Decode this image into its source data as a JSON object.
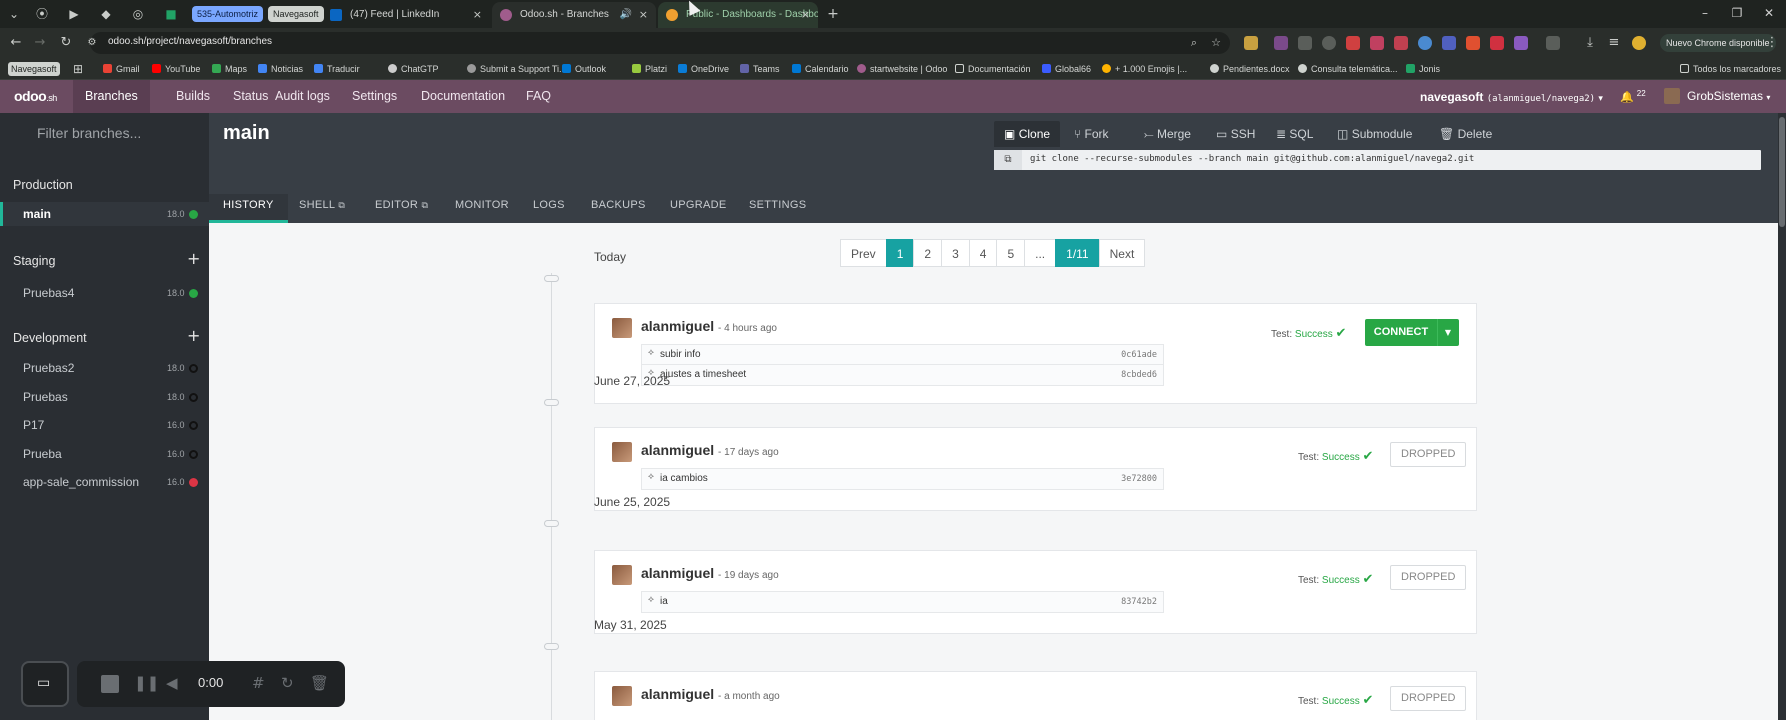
{
  "browser": {
    "tab_groups": [
      {
        "label": "535-Automotriz",
        "color": "#7aa7ff"
      },
      {
        "label": "Navegasoft",
        "color": "#cfd3cf"
      }
    ],
    "tabs": [
      {
        "title": "(47) Feed | LinkedIn",
        "icon": "linkedin-icon",
        "color": "#0a66c2"
      },
      {
        "title": "Odoo.sh - Branches",
        "icon": "odoo-icon",
        "color": "#a05c8c"
      },
      {
        "title": "Public - Dashboards - Dashboa",
        "icon": "dashboard-icon",
        "color": "#f0a030"
      }
    ],
    "url": "odoo.sh/project/navegasoft/branches",
    "update_label": "Nuevo Chrome disponible",
    "bookmarks": [
      {
        "label": "Navegasoft",
        "color": "#cfd3cf"
      },
      {
        "label": "Gmail",
        "color": "#ea4335"
      },
      {
        "label": "YouTube",
        "color": "#ff0000"
      },
      {
        "label": "Maps",
        "color": "#34a853"
      },
      {
        "label": "Noticias",
        "color": "#4285f4"
      },
      {
        "label": "Traducir",
        "color": "#4285f4"
      },
      {
        "label": "ChatGTP",
        "color": "#cccccc"
      },
      {
        "label": "Submit a Support Ti...",
        "color": "#9a9a9a"
      },
      {
        "label": "Outlook",
        "color": "#0078d4"
      },
      {
        "label": "Platzi",
        "color": "#98ca3f"
      },
      {
        "label": "OneDrive",
        "color": "#0a7cd6"
      },
      {
        "label": "Teams",
        "color": "#6264a7"
      },
      {
        "label": "Calendario",
        "color": "#0078d4"
      },
      {
        "label": "startwebsite | Odoo",
        "color": "#a05c8c"
      },
      {
        "label": "Documentación",
        "color": "#cfd3cf"
      },
      {
        "label": "Global66",
        "color": "#3b5cff"
      },
      {
        "label": "+ 1.000 Emojis |...",
        "color": "#ffb400"
      },
      {
        "label": "Pendientes.docx",
        "color": "#cfd3cf"
      },
      {
        "label": "Consulta telemática...",
        "color": "#cfd3cf"
      },
      {
        "label": "Jonis",
        "color": "#21a366"
      }
    ],
    "all_bookmarks_label": "Todos los marcadores"
  },
  "odoo_nav": {
    "logo": "odoo",
    "logo_suffix": ".sh",
    "links": [
      "Branches",
      "Builds",
      "Status",
      "Audit logs",
      "Settings",
      "Documentation",
      "FAQ"
    ],
    "project": "navegasoft",
    "project_repo": "(alanmiguel/navega2)",
    "notifications": "22",
    "user": "GrobSistemas"
  },
  "sidebar": {
    "filter_placeholder": "Filter branches...",
    "sections": [
      {
        "title": "Production",
        "branches": [
          {
            "name": "main",
            "version": "18.0",
            "status": "#28a745"
          }
        ]
      },
      {
        "title": "Staging",
        "branches": [
          {
            "name": "Pruebas4",
            "version": "18.0",
            "status": "#28a745"
          }
        ]
      },
      {
        "title": "Development",
        "branches": [
          {
            "name": "Pruebas2",
            "version": "18.0",
            "status": "#1a1a1a"
          },
          {
            "name": "Pruebas",
            "version": "18.0",
            "status": "#1a1a1a"
          },
          {
            "name": "P17",
            "version": "16.0",
            "status": "#1a1a1a"
          },
          {
            "name": "Prueba",
            "version": "16.0",
            "status": "#1a1a1a"
          },
          {
            "name": "app-sale_commission",
            "version": "16.0",
            "status": "#dc3545"
          }
        ]
      }
    ]
  },
  "header": {
    "branch": "main",
    "actions": [
      "Clone",
      "Fork",
      "Merge",
      "SSH",
      "SQL",
      "Submodule",
      "Delete"
    ],
    "clone_command": "git clone --recurse-submodules --branch main git@github.com:alanmiguel/navega2.git",
    "tabs": [
      "HISTORY",
      "SHELL",
      "EDITOR",
      "MONITOR",
      "LOGS",
      "BACKUPS",
      "UPGRADE",
      "SETTINGS"
    ]
  },
  "pager": {
    "prev": "Prev",
    "pages": [
      "1",
      "2",
      "3",
      "4",
      "5",
      "..."
    ],
    "current": "1/11",
    "next": "Next"
  },
  "history": [
    {
      "day": "Today",
      "author": "alanmiguel",
      "ago": "- 4 hours ago",
      "commits": [
        {
          "message": "subir info",
          "hash": "0c61ade"
        },
        {
          "message": "ajustes a timesheet",
          "hash": "8cbded6"
        }
      ],
      "test_label": "Test:",
      "test_result": "Success",
      "action": "CONNECT"
    },
    {
      "day": "June 27, 2025",
      "author": "alanmiguel",
      "ago": "- 17 days ago",
      "commits": [
        {
          "message": "ia cambios",
          "hash": "3e72800"
        }
      ],
      "test_label": "Test:",
      "test_result": "Success",
      "action": "DROPPED"
    },
    {
      "day": "June 25, 2025",
      "author": "alanmiguel",
      "ago": "- 19 days ago",
      "commits": [
        {
          "message": "ia",
          "hash": "83742b2"
        }
      ],
      "test_label": "Test:",
      "test_result": "Success",
      "action": "DROPPED"
    },
    {
      "day": "May 31, 2025",
      "author": "alanmiguel",
      "ago": "- a month ago",
      "commits": [],
      "test_label": "Test:",
      "test_result": "Success",
      "action": "DROPPED"
    }
  ],
  "recorder": {
    "time": "0:00"
  }
}
